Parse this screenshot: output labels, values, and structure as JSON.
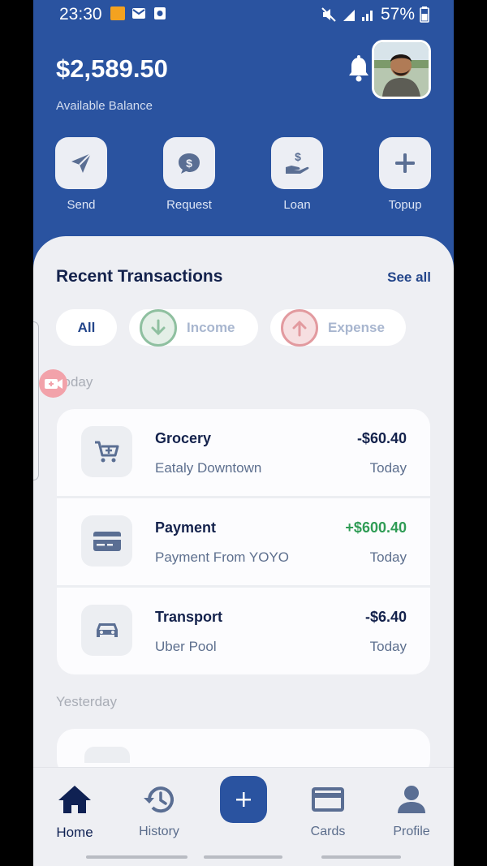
{
  "status_bar": {
    "time": "23:30",
    "battery": "57%",
    "left_icons": [
      "notification-app-icon",
      "mail-icon",
      "screen-record-icon"
    ],
    "right_icons": [
      "mute-icon",
      "signal-r-icon",
      "signal-icon",
      "battery-icon"
    ]
  },
  "header": {
    "balance": "$2,589.50",
    "balance_label": "Available Balance",
    "bell_icon": "bell-icon"
  },
  "actions": [
    {
      "label": "Send",
      "icon": "send-icon"
    },
    {
      "label": "Request",
      "icon": "request-icon"
    },
    {
      "label": "Loan",
      "icon": "loan-icon"
    },
    {
      "label": "Topup",
      "icon": "plus-icon"
    }
  ],
  "transactions_section": {
    "title": "Recent Transactions",
    "see_all": "See all",
    "filters": {
      "all": "All",
      "income": "Income",
      "expense": "Expense"
    },
    "today_label": "Today",
    "yesterday_label": "Yesterday"
  },
  "transactions": [
    {
      "name": "Grocery",
      "sub": "Eataly Downtown",
      "amount": "-$60.40",
      "date": "Today",
      "icon": "cart-icon",
      "positive": false
    },
    {
      "name": "Payment",
      "sub": "Payment From YOYO",
      "amount": "+$600.40",
      "date": "Today",
      "icon": "card-icon",
      "positive": true
    },
    {
      "name": "Transport",
      "sub": "Uber Pool",
      "amount": "-$6.40",
      "date": "Today",
      "icon": "car-icon",
      "positive": false
    }
  ],
  "nav": {
    "home": "Home",
    "history": "History",
    "cards": "Cards",
    "profile": "Profile"
  },
  "colors": {
    "primary": "#2a53a0",
    "navy": "#14224c",
    "positive": "#2f9c55",
    "income_accent": "#8fc0a0",
    "expense_accent": "#e29a9f"
  }
}
